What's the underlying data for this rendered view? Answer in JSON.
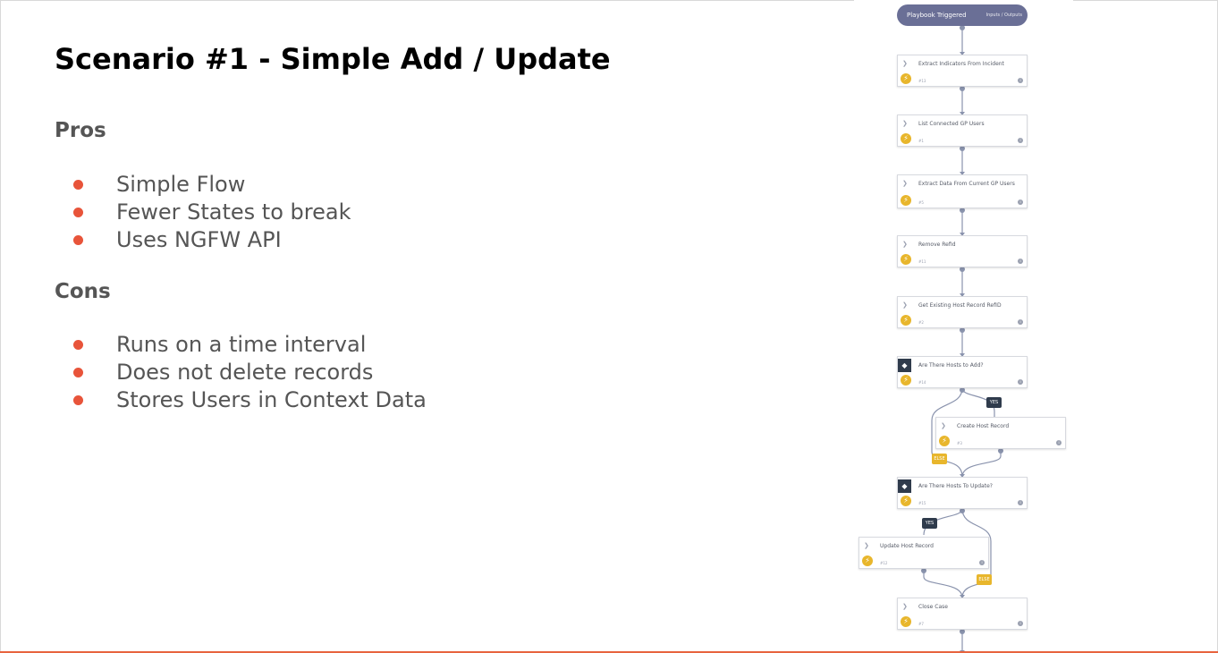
{
  "title": "Scenario #1 - Simple Add / Update",
  "pros": {
    "heading": "Pros",
    "items": [
      "Simple Flow",
      "Fewer States to break",
      "Uses NGFW API"
    ]
  },
  "cons": {
    "heading": "Cons",
    "items": [
      "Runs on a time interval",
      "Does not delete records",
      "Stores Users in Context Data"
    ]
  },
  "colors": {
    "bullet": "#e8543a",
    "accent_bar": "#e8643f",
    "trigger": "#6a6f96",
    "condition": "#2f3b4c",
    "else_tag": "#e8b62c"
  },
  "playbook": {
    "trigger": {
      "label": "Playbook Triggered",
      "io_label": "Inputs / Outputs"
    },
    "tasks": [
      {
        "label": "Extract Indicators From Incident",
        "id": "#13",
        "kind": "task"
      },
      {
        "label": "List Connected GP Users",
        "id": "#1",
        "kind": "task"
      },
      {
        "label": "Extract Data From Current GP Users",
        "id": "#5",
        "kind": "task"
      },
      {
        "label": "Remove RefId",
        "id": "#11",
        "kind": "task"
      },
      {
        "label": "Get Existing Host Record RefID",
        "id": "#2",
        "kind": "task"
      },
      {
        "label": "Are There Hosts to Add?",
        "id": "#14",
        "kind": "condition"
      },
      {
        "label": "Create Host Record",
        "id": "#3",
        "kind": "task"
      },
      {
        "label": "Are There Hosts To Update?",
        "id": "#15",
        "kind": "condition"
      },
      {
        "label": "Update Host Record",
        "id": "#12",
        "kind": "task"
      },
      {
        "label": "Close Case",
        "id": "#7",
        "kind": "task"
      }
    ],
    "branch_labels": {
      "yes": "YES",
      "else": "ELSE"
    }
  }
}
